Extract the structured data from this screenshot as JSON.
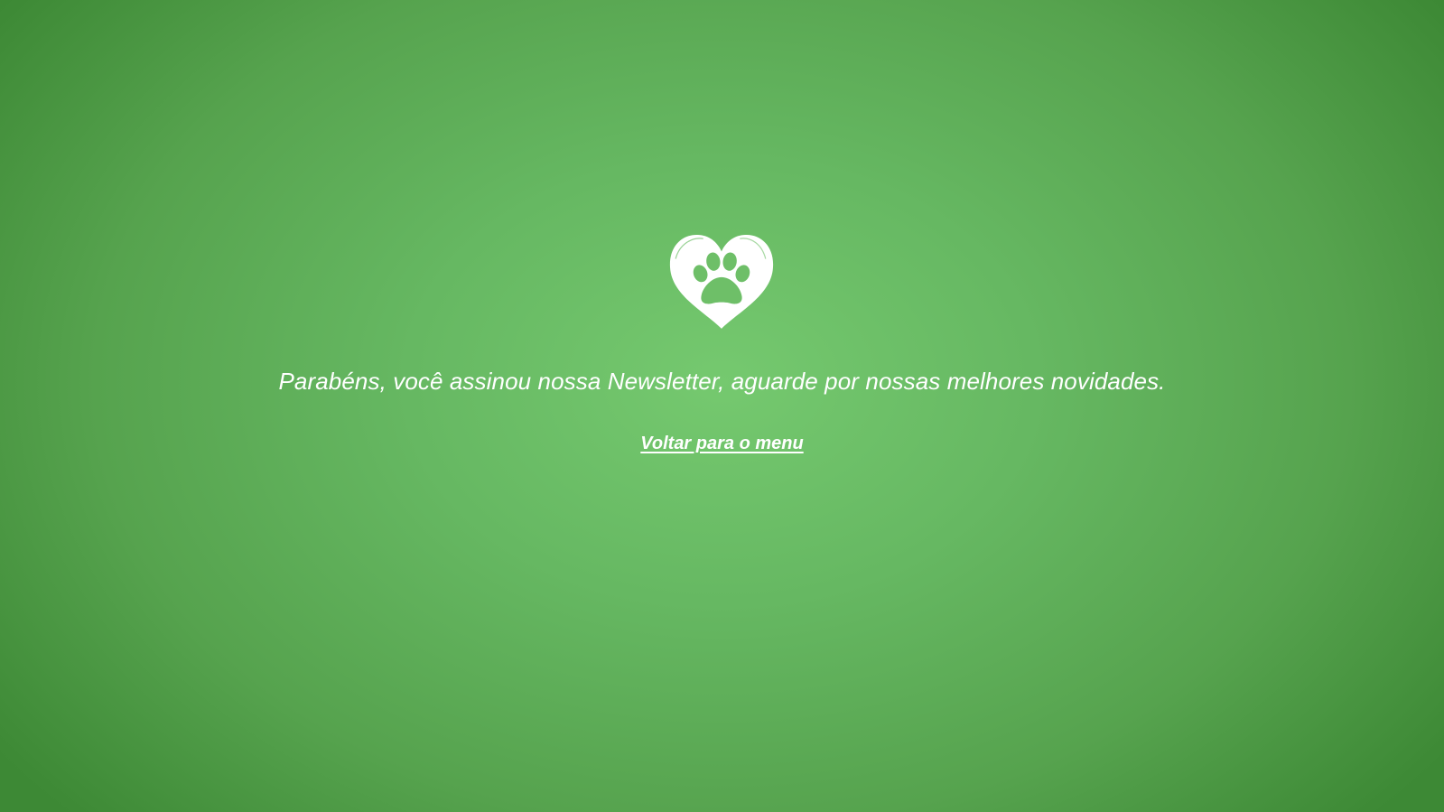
{
  "logo": {
    "icon": "heart-paw-icon",
    "color": "#ffffff"
  },
  "confirmation": {
    "message": "Parabéns, você assinou nossa Newsletter, aguarde por nossas melhores novidades."
  },
  "navigation": {
    "back_label": "Voltar para o menu"
  },
  "colors": {
    "background_center": "#75c96f",
    "background_edge": "#3d8935",
    "text": "#ffffff"
  }
}
